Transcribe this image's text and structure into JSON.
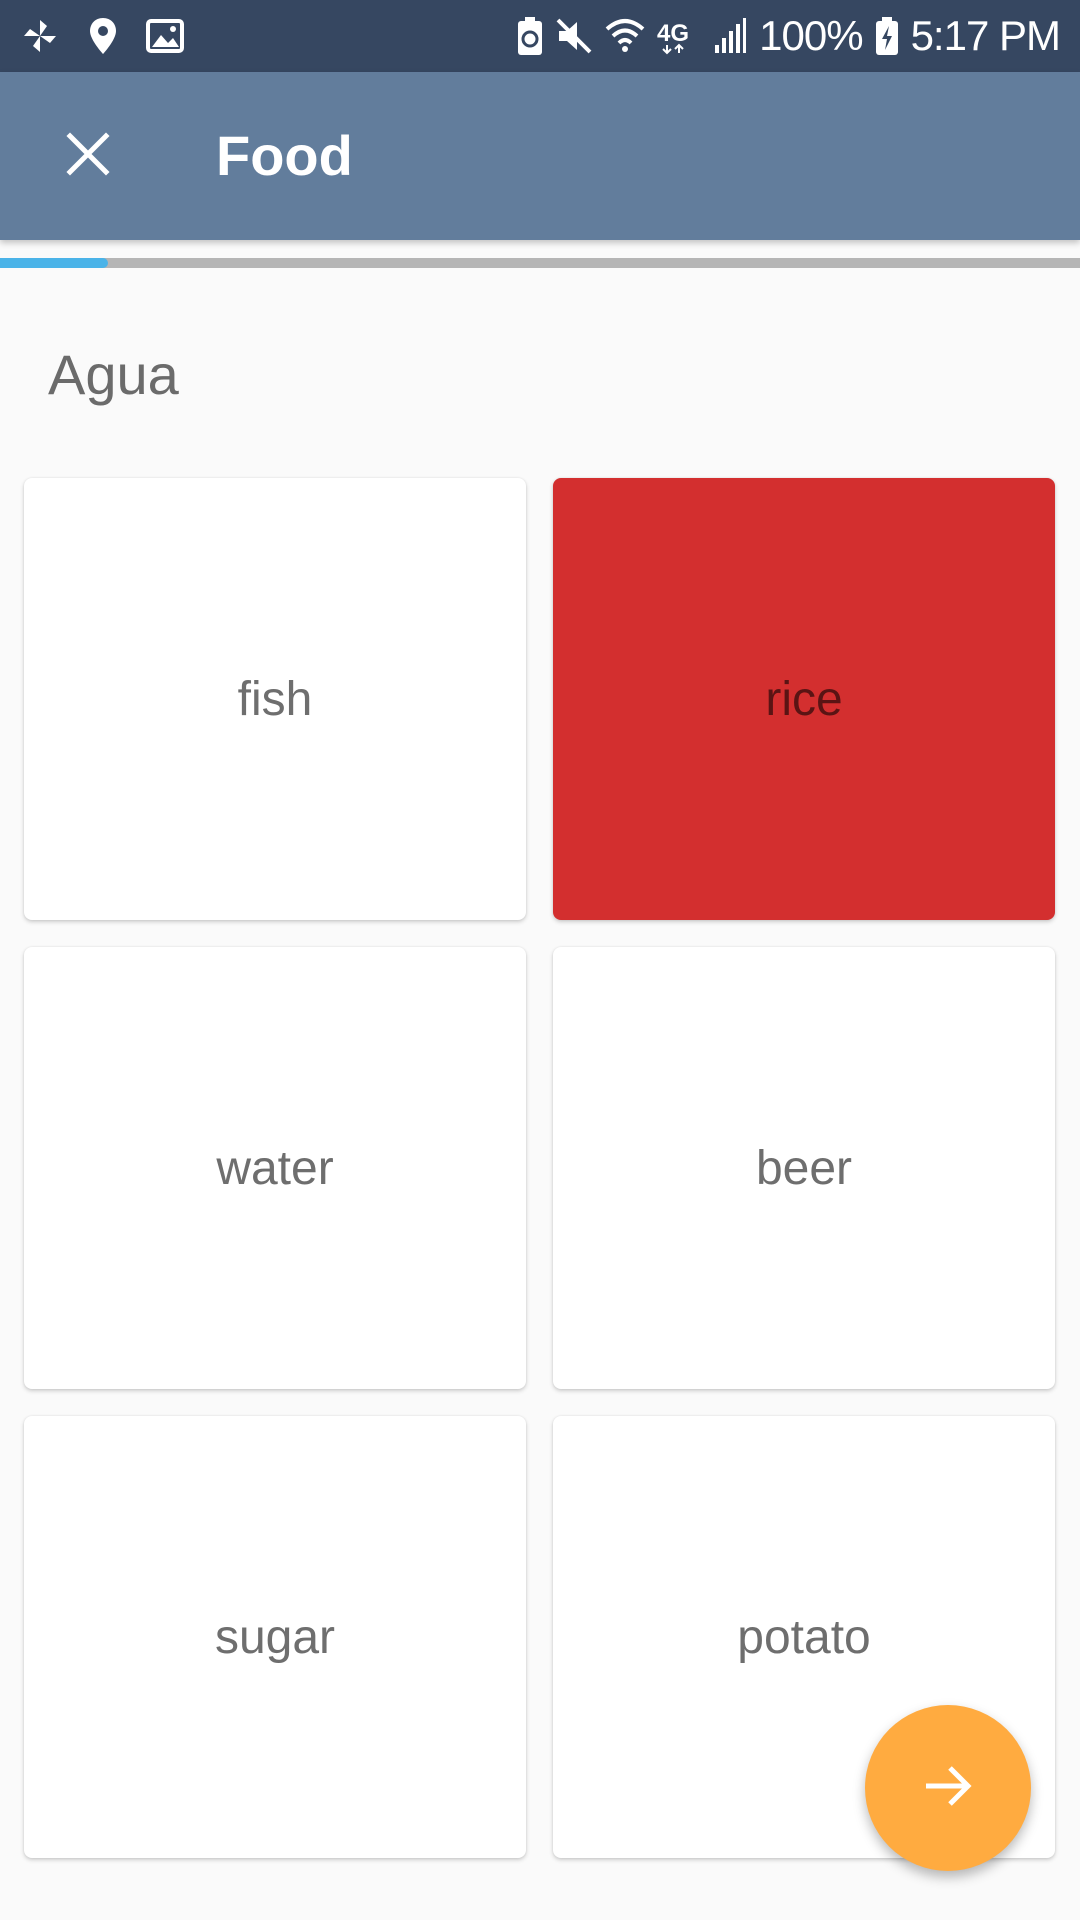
{
  "status_bar": {
    "battery_percent": "100%",
    "time": "5:17 PM",
    "left_icons": [
      "fan-icon",
      "location-pin-icon",
      "image-icon"
    ],
    "right_icons": [
      "battery-saver-icon",
      "mute-icon",
      "wifi-icon",
      "4g-lte-icon",
      "signal-icon",
      "battery-charging-icon"
    ]
  },
  "app_bar": {
    "title": "Food",
    "close_icon": "close-icon"
  },
  "progress": {
    "value": 0.1
  },
  "prompt": {
    "word": "Agua"
  },
  "options": [
    {
      "label": "fish",
      "selected": false
    },
    {
      "label": "rice",
      "selected": true
    },
    {
      "label": "water",
      "selected": false
    },
    {
      "label": "beer",
      "selected": false
    },
    {
      "label": "sugar",
      "selected": false
    },
    {
      "label": "potato",
      "selected": false
    }
  ],
  "fab": {
    "icon": "arrow-right-icon"
  },
  "colors": {
    "status_bar": "#364761",
    "app_bar": "#627d9c",
    "progress_fill": "#4ab3e8",
    "progress_track": "#b5b5b5",
    "selected_card": "#d32f2f",
    "fab": "#ffab40"
  }
}
